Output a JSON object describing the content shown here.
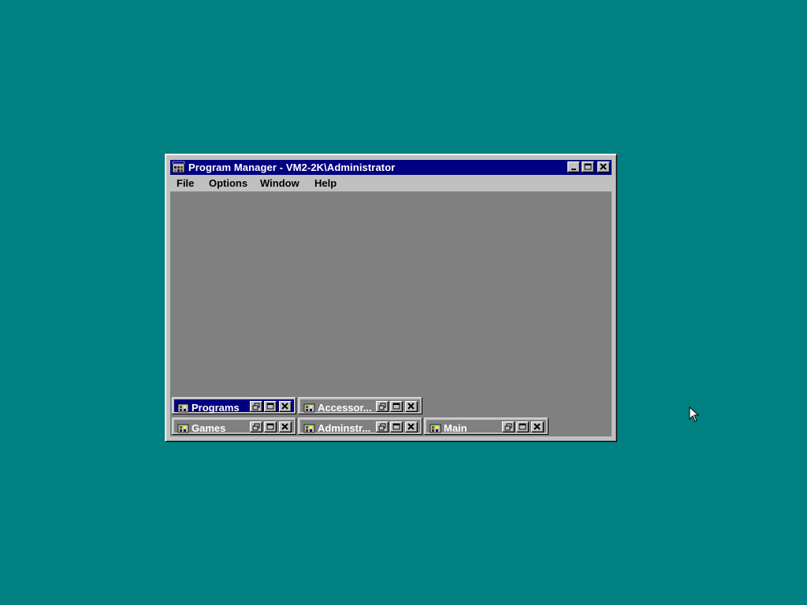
{
  "desktop": {
    "background_color": "#008080"
  },
  "window": {
    "title": "Program Manager - VM2-2K\\Administrator",
    "icon": "program-manager-icon",
    "title_color": "#000080",
    "client_color": "#808080"
  },
  "menu": {
    "items": [
      {
        "label": "File"
      },
      {
        "label": "Options"
      },
      {
        "label": "Window"
      },
      {
        "label": "Help"
      }
    ]
  },
  "groups": [
    {
      "label": "Programs",
      "active": true,
      "icon": "program-group-icon"
    },
    {
      "label": "Accessor...",
      "active": false,
      "icon": "program-group-icon"
    },
    {
      "label": "Games",
      "active": false,
      "icon": "program-group-icon"
    },
    {
      "label": "Adminstr...",
      "active": false,
      "icon": "program-group-icon"
    },
    {
      "label": "Main",
      "active": false,
      "icon": "program-group-icon"
    }
  ]
}
